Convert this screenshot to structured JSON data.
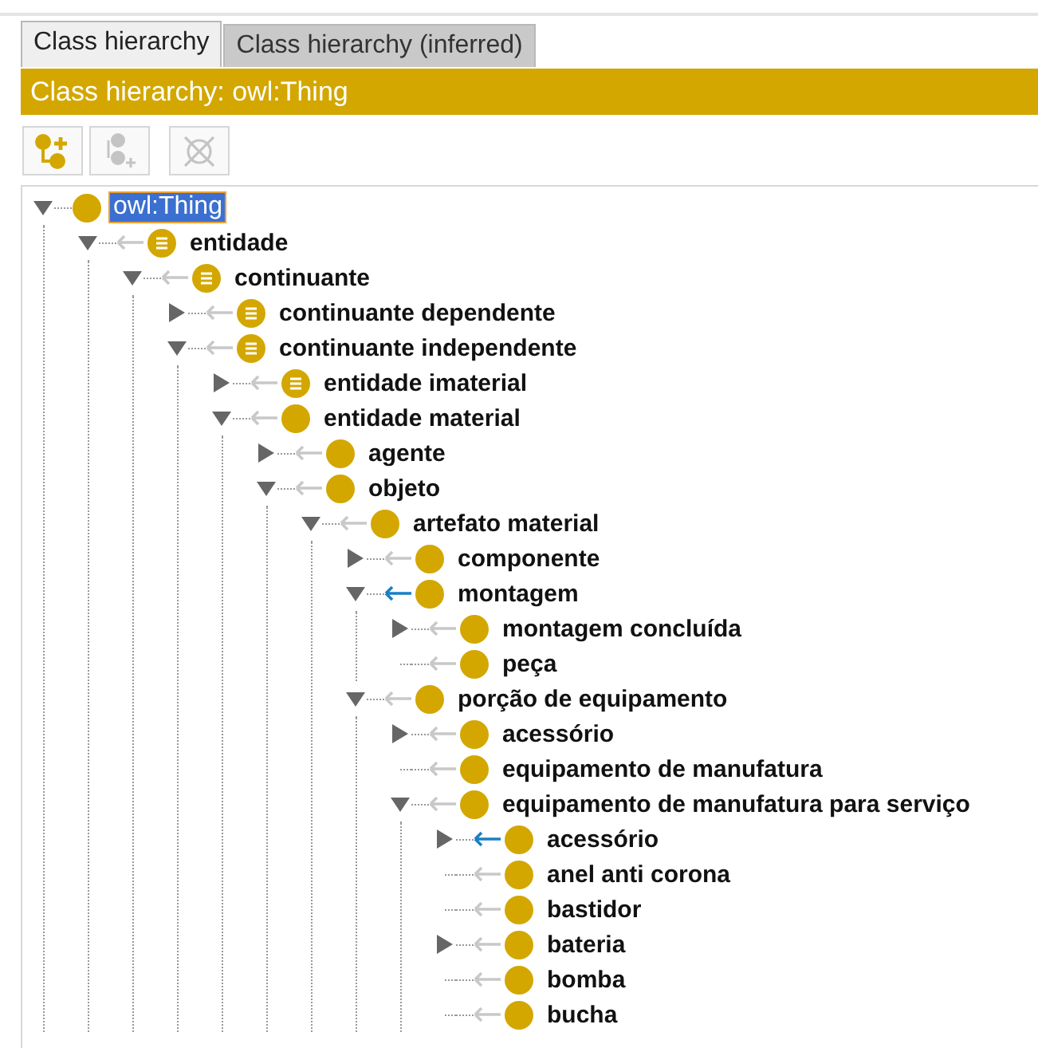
{
  "tabs": [
    {
      "label": "Class hierarchy",
      "selected": true
    },
    {
      "label": "Class hierarchy (inferred)",
      "selected": false
    }
  ],
  "header": {
    "title": "Class hierarchy: owl:Thing"
  },
  "toolbar": [
    {
      "kind": "add-subclass",
      "disabled": false
    },
    {
      "kind": "add-sibling",
      "disabled": true
    },
    {
      "kind": "delete",
      "disabled": true
    }
  ],
  "tree": [
    {
      "label": "owl:Thing",
      "kind": "primitive",
      "leaf": false,
      "expanded": true,
      "selected": true,
      "children": [
        {
          "label": "entidade",
          "kind": "defined",
          "leaf": false,
          "expanded": true,
          "highlighted": false,
          "selected": false,
          "children": [
            {
              "label": "continuante",
              "kind": "defined",
              "leaf": false,
              "expanded": true,
              "highlighted": false,
              "selected": false,
              "children": [
                {
                  "label": "continuante dependente",
                  "kind": "defined",
                  "leaf": false,
                  "expanded": false,
                  "highlighted": false,
                  "selected": false
                },
                {
                  "label": "continuante independente",
                  "kind": "defined",
                  "leaf": false,
                  "expanded": true,
                  "highlighted": false,
                  "selected": false,
                  "children": [
                    {
                      "label": "entidade imaterial",
                      "kind": "defined",
                      "leaf": false,
                      "expanded": false,
                      "highlighted": false,
                      "selected": false
                    },
                    {
                      "label": "entidade material",
                      "kind": "primitive",
                      "leaf": false,
                      "expanded": true,
                      "highlighted": false,
                      "selected": false,
                      "children": [
                        {
                          "label": "agente",
                          "kind": "primitive",
                          "leaf": false,
                          "expanded": false,
                          "highlighted": false,
                          "selected": false
                        },
                        {
                          "label": "objeto",
                          "kind": "primitive",
                          "leaf": false,
                          "expanded": true,
                          "highlighted": false,
                          "selected": false,
                          "children": [
                            {
                              "label": "artefato material",
                              "kind": "primitive",
                              "leaf": false,
                              "expanded": true,
                              "highlighted": false,
                              "selected": false,
                              "children": [
                                {
                                  "label": "componente",
                                  "kind": "primitive",
                                  "leaf": false,
                                  "expanded": false,
                                  "highlighted": false,
                                  "selected": false
                                },
                                {
                                  "label": "montagem",
                                  "kind": "primitive",
                                  "leaf": false,
                                  "expanded": true,
                                  "highlighted": true,
                                  "selected": false,
                                  "children": [
                                    {
                                      "label": "montagem concluída",
                                      "kind": "primitive",
                                      "leaf": false,
                                      "expanded": false,
                                      "highlighted": false,
                                      "selected": false
                                    },
                                    {
                                      "label": "peça",
                                      "kind": "primitive",
                                      "leaf": true,
                                      "highlighted": false,
                                      "selected": false
                                    }
                                  ]
                                },
                                {
                                  "label": "porção de equipamento",
                                  "kind": "primitive",
                                  "leaf": false,
                                  "expanded": true,
                                  "highlighted": false,
                                  "selected": false,
                                  "children": [
                                    {
                                      "label": "acessório",
                                      "kind": "primitive",
                                      "leaf": false,
                                      "expanded": false,
                                      "highlighted": false,
                                      "selected": false
                                    },
                                    {
                                      "label": "equipamento de manufatura",
                                      "kind": "primitive",
                                      "leaf": true,
                                      "highlighted": false,
                                      "selected": false
                                    },
                                    {
                                      "label": "equipamento de manufatura para serviço",
                                      "kind": "primitive",
                                      "leaf": false,
                                      "expanded": true,
                                      "highlighted": false,
                                      "selected": false,
                                      "children": [
                                        {
                                          "label": "acessório",
                                          "kind": "primitive",
                                          "leaf": false,
                                          "expanded": false,
                                          "highlighted": true,
                                          "selected": false
                                        },
                                        {
                                          "label": "anel anti corona",
                                          "kind": "primitive",
                                          "leaf": true,
                                          "highlighted": false,
                                          "selected": false
                                        },
                                        {
                                          "label": "bastidor",
                                          "kind": "primitive",
                                          "leaf": true,
                                          "highlighted": false,
                                          "selected": false
                                        },
                                        {
                                          "label": "bateria",
                                          "kind": "primitive",
                                          "leaf": false,
                                          "expanded": false,
                                          "highlighted": false,
                                          "selected": false
                                        },
                                        {
                                          "label": "bomba",
                                          "kind": "primitive",
                                          "leaf": true,
                                          "highlighted": false,
                                          "selected": false
                                        },
                                        {
                                          "label": "bucha",
                                          "kind": "primitive",
                                          "leaf": true,
                                          "highlighted": false,
                                          "selected": false
                                        }
                                      ]
                                    }
                                  ]
                                }
                              ]
                            }
                          ]
                        }
                      ]
                    }
                  ]
                }
              ]
            }
          ]
        }
      ]
    }
  ]
}
